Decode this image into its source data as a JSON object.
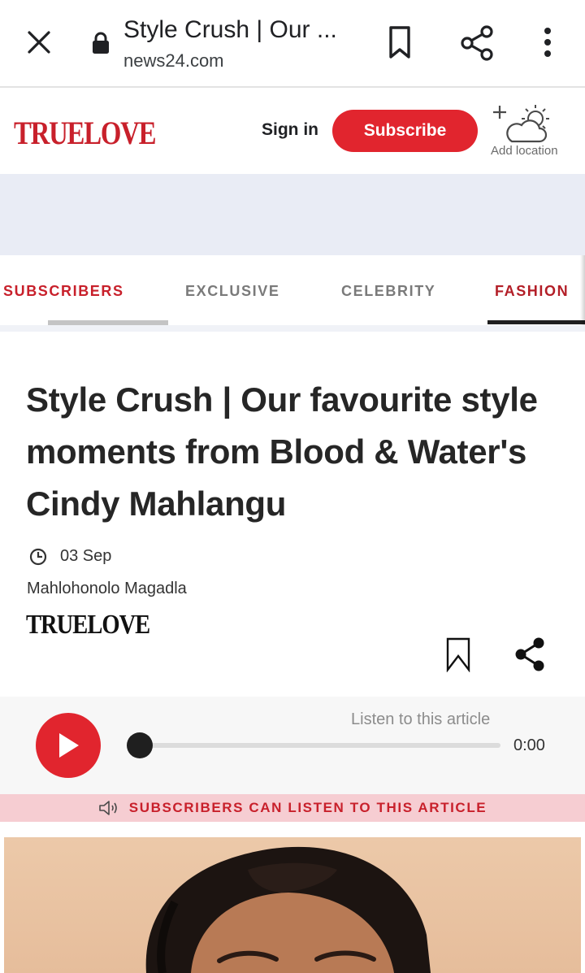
{
  "browser": {
    "title": "Style Crush | Our ...",
    "domain": "news24.com",
    "icons": [
      "close-icon",
      "lock-icon",
      "bookmark-icon",
      "share-icon",
      "more-vert-icon"
    ]
  },
  "header": {
    "logo": "TRUELOVE",
    "sign_in": "Sign in",
    "subscribe": "Subscribe",
    "add_location": "Add location",
    "brand_color": "#e1252e"
  },
  "tabs": [
    {
      "label": "SUBSCRIBERS"
    },
    {
      "label": "EXCLUSIVE"
    },
    {
      "label": "CELEBRITY"
    },
    {
      "label": "FASHION",
      "active": true
    }
  ],
  "article": {
    "headline": "Style Crush | Our favourite style moments from Blood & Water's Cindy Mahlangu",
    "date": "03 Sep",
    "author": "Mahlohonolo Magadla",
    "source_logo": "TRUELOVE"
  },
  "player": {
    "listen_label": "Listen to this article",
    "time": "0:00",
    "progress": 0
  },
  "notice": {
    "text": "SUBSCRIBERS CAN LISTEN TO THIS ARTICLE"
  }
}
